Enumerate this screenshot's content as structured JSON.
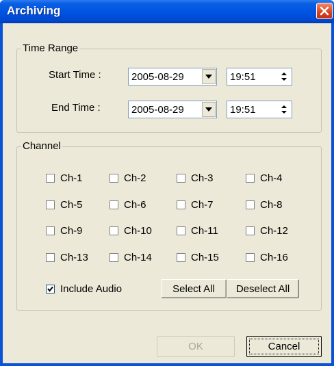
{
  "window": {
    "title": "Archiving"
  },
  "time_range": {
    "title": "Time Range",
    "start_label": "Start Time :",
    "start_date": "2005-08-29",
    "start_time": "19:51",
    "end_label": "End Time :",
    "end_date": "2005-08-29",
    "end_time": "19:51"
  },
  "channel": {
    "title": "Channel",
    "channels": [
      {
        "label": "Ch-1",
        "checked": false
      },
      {
        "label": "Ch-2",
        "checked": false
      },
      {
        "label": "Ch-3",
        "checked": false
      },
      {
        "label": "Ch-4",
        "checked": false
      },
      {
        "label": "Ch-5",
        "checked": false
      },
      {
        "label": "Ch-6",
        "checked": false
      },
      {
        "label": "Ch-7",
        "checked": false
      },
      {
        "label": "Ch-8",
        "checked": false
      },
      {
        "label": "Ch-9",
        "checked": false
      },
      {
        "label": "Ch-10",
        "checked": false
      },
      {
        "label": "Ch-11",
        "checked": false
      },
      {
        "label": "Ch-12",
        "checked": false
      },
      {
        "label": "Ch-13",
        "checked": false
      },
      {
        "label": "Ch-14",
        "checked": false
      },
      {
        "label": "Ch-15",
        "checked": false
      },
      {
        "label": "Ch-16",
        "checked": false
      }
    ],
    "include_audio_label": "Include Audio",
    "include_audio_checked": true,
    "select_all_label": "Select All",
    "deselect_all_label": "Deselect All"
  },
  "footer": {
    "ok_label": "OK",
    "ok_enabled": false,
    "cancel_label": "Cancel"
  }
}
